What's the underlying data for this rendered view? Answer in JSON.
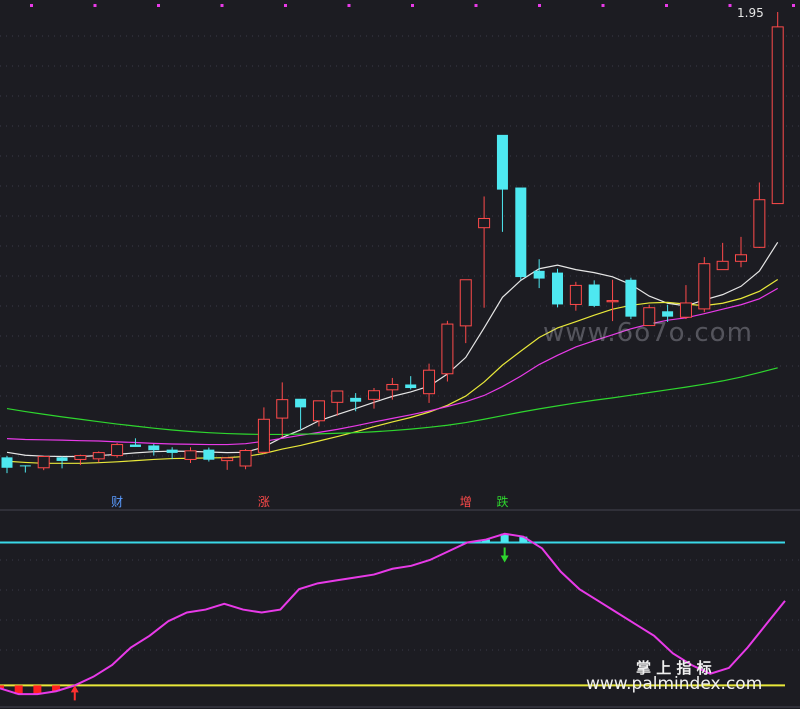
{
  "chart_data": [
    {
      "type": "candlestick",
      "price_label": "1.95",
      "ylim": [
        0,
        100
      ],
      "candles": [
        {
          "o": 50.3,
          "h": 50.8,
          "l": 45.0,
          "c": 46.8,
          "up": false
        },
        {
          "o": 47.6,
          "h": 47.6,
          "l": 45.2,
          "c": 47.5,
          "up": false
        },
        {
          "o": 46.8,
          "h": 50.7,
          "l": 46.0,
          "c": 50.6,
          "up": true
        },
        {
          "o": 49.1,
          "h": 50.6,
          "l": 46.6,
          "c": 50.3,
          "up": false
        },
        {
          "o": 49.6,
          "h": 51.2,
          "l": 47.7,
          "c": 50.9,
          "up": true
        },
        {
          "o": 49.8,
          "h": 52.3,
          "l": 48.6,
          "c": 51.9,
          "up": true
        },
        {
          "o": 50.9,
          "h": 55.1,
          "l": 50.2,
          "c": 54.6,
          "up": true
        },
        {
          "o": 54.6,
          "h": 56.7,
          "l": 53.9,
          "c": 53.8,
          "up": false
        },
        {
          "o": 54.3,
          "h": 54.8,
          "l": 50.9,
          "c": 52.7,
          "up": false
        },
        {
          "o": 52.9,
          "h": 53.7,
          "l": 49.7,
          "c": 51.8,
          "up": false
        },
        {
          "o": 49.6,
          "h": 53.7,
          "l": 48.4,
          "c": 52.5,
          "up": true
        },
        {
          "o": 52.9,
          "h": 53.6,
          "l": 48.9,
          "c": 49.5,
          "up": false
        },
        {
          "o": 49.2,
          "h": 50.4,
          "l": 46.1,
          "c": 50.1,
          "up": true
        },
        {
          "o": 47.4,
          "h": 53.1,
          "l": 46.3,
          "c": 52.6,
          "up": true
        },
        {
          "o": 52.0,
          "h": 67.1,
          "l": 51.5,
          "c": 63.1,
          "up": true
        },
        {
          "o": 63.5,
          "h": 75.5,
          "l": 57.1,
          "c": 69.7,
          "up": true
        },
        {
          "o": 70.0,
          "h": 68.4,
          "l": 59.8,
          "c": 67.1,
          "up": false
        },
        {
          "o": 62.6,
          "h": 69.4,
          "l": 60.7,
          "c": 69.3,
          "up": true
        },
        {
          "o": 68.8,
          "h": 72.5,
          "l": 64.3,
          "c": 72.6,
          "up": true
        },
        {
          "o": 70.3,
          "h": 71.9,
          "l": 65.8,
          "c": 69.0,
          "up": false
        },
        {
          "o": 69.8,
          "h": 73.6,
          "l": 66.7,
          "c": 72.7,
          "up": true
        },
        {
          "o": 73.0,
          "h": 77.0,
          "l": 69.7,
          "c": 74.8,
          "up": true
        },
        {
          "o": 73.6,
          "h": 77.6,
          "l": 73.1,
          "c": 74.8,
          "up": false
        },
        {
          "o": 71.7,
          "h": 81.8,
          "l": 68.6,
          "c": 79.6,
          "up": true
        },
        {
          "o": 78.4,
          "h": 96.2,
          "l": 75.8,
          "c": 95.1,
          "up": true
        },
        {
          "o": 94.5,
          "h": 108.9,
          "l": 88.7,
          "c": 110.0,
          "up": true
        },
        {
          "o": 127.5,
          "h": 138.0,
          "l": 100.6,
          "c": 130.6,
          "up": true
        },
        {
          "o": 158.7,
          "h": 154.7,
          "l": 126.1,
          "c": 140.3,
          "up": false
        },
        {
          "o": 141.0,
          "h": 140.6,
          "l": 110.0,
          "c": 110.9,
          "up": false
        },
        {
          "o": 113.0,
          "h": 116.9,
          "l": 107.2,
          "c": 110.4,
          "up": false
        },
        {
          "o": 112.4,
          "h": 113.7,
          "l": 100.7,
          "c": 101.7,
          "up": false
        },
        {
          "o": 101.7,
          "h": 109.3,
          "l": 99.6,
          "c": 108.1,
          "up": true
        },
        {
          "o": 108.4,
          "h": 109.8,
          "l": 100.8,
          "c": 101.2,
          "up": false
        },
        {
          "o": 102.6,
          "h": 110.0,
          "l": 96.1,
          "c": 103.0,
          "up": true
        },
        {
          "o": 110.0,
          "h": 110.7,
          "l": 96.8,
          "c": 97.6,
          "up": false
        },
        {
          "o": 94.6,
          "h": 101.6,
          "l": 94.5,
          "c": 100.6,
          "up": true
        },
        {
          "o": 99.4,
          "h": 101.6,
          "l": 95.8,
          "c": 97.6,
          "up": false
        },
        {
          "o": 97.4,
          "h": 108.2,
          "l": 96.8,
          "c": 102.2,
          "up": true
        },
        {
          "o": 100.2,
          "h": 117.6,
          "l": 99.1,
          "c": 115.4,
          "up": true
        },
        {
          "o": 113.4,
          "h": 122.4,
          "l": 113.9,
          "c": 116.2,
          "up": true
        },
        {
          "o": 116.2,
          "h": 124.4,
          "l": 114.2,
          "c": 118.4,
          "up": true
        },
        {
          "o": 120.9,
          "h": 142.7,
          "l": 120.7,
          "c": 136.9,
          "up": true
        },
        {
          "o": 135.6,
          "h": 200.0,
          "l": 138.3,
          "c": 195.0,
          "up": true
        }
      ],
      "ma_series": [
        {
          "color": "#e6e6e6",
          "values": [
            52,
            51,
            50.7,
            50.6,
            50.6,
            50.9,
            51.3,
            51.8,
            52.2,
            52.4,
            52.3,
            52.1,
            51.9,
            52.0,
            53.8,
            57.0,
            59.5,
            62.6,
            64.7,
            66.7,
            68.8,
            70.8,
            72.3,
            74.2,
            78.3,
            83.9,
            93.8,
            104.1,
            109.8,
            113.7,
            114.9,
            113.4,
            112.4,
            111.0,
            108.4,
            104.5,
            102.1,
            101.2,
            103.2,
            105.0,
            107.8,
            112.9,
            122.6
          ]
        },
        {
          "color": "#e8e83a",
          "values": [
            49,
            48.6,
            48.3,
            48.3,
            48.3,
            48.5,
            48.8,
            49.2,
            49.6,
            49.9,
            50.0,
            50.1,
            50.2,
            50.6,
            51.6,
            53.1,
            54.3,
            55.8,
            57.3,
            58.9,
            60.6,
            62.2,
            63.7,
            65.5,
            67.8,
            70.9,
            75.6,
            81.3,
            86.0,
            90.6,
            93.8,
            95.9,
            98.1,
            100.1,
            101.4,
            102.2,
            102.4,
            101.8,
            101.3,
            102.1,
            103.7,
            106.1,
            110.1
          ]
        },
        {
          "color": "#e83ae8",
          "values": [
            56.6,
            56.3,
            56.2,
            56.1,
            55.9,
            55.8,
            55.5,
            55.3,
            55.0,
            54.8,
            54.7,
            54.6,
            54.6,
            54.9,
            55.7,
            56.7,
            57.7,
            58.7,
            59.7,
            60.9,
            62.2,
            63.4,
            64.6,
            65.9,
            67.4,
            69.0,
            71.1,
            74.1,
            77.6,
            81.5,
            84.6,
            87.4,
            89.5,
            91.5,
            93.5,
            95.1,
            96.4,
            97.2,
            98.6,
            100.1,
            101.6,
            103.6,
            107.1
          ]
        },
        {
          "color": "#2ed62e",
          "values": [
            66.7,
            65.7,
            64.8,
            63.9,
            63.1,
            62.3,
            61.5,
            60.8,
            60.1,
            59.5,
            59.0,
            58.6,
            58.3,
            58.1,
            58.0,
            58.0,
            58.1,
            58.2,
            58.4,
            58.6,
            58.9,
            59.3,
            59.8,
            60.4,
            61.1,
            62.0,
            63.1,
            64.3,
            65.5,
            66.6,
            67.6,
            68.6,
            69.5,
            70.3,
            71.2,
            72.1,
            73.0,
            73.9,
            74.9,
            76.0,
            77.3,
            78.8,
            80.4
          ]
        }
      ],
      "markers": [
        {
          "label": "财",
          "index": 6,
          "color": "#5a9bff"
        },
        {
          "label": "涨",
          "index": 14,
          "color": "#ff4a4a"
        },
        {
          "label": "增",
          "index": 25,
          "color": "#ff4a4a"
        },
        {
          "label": "跌",
          "index": 27,
          "color": "#2ed62e"
        }
      ],
      "watermark": "www.6o7o.com"
    },
    {
      "type": "line",
      "x": [
        0,
        1,
        2,
        3,
        4,
        5,
        6,
        7,
        8,
        9,
        10,
        11,
        12,
        13,
        14,
        15,
        16,
        17,
        18,
        19,
        20,
        21,
        22,
        23,
        24,
        25,
        26,
        27,
        28,
        29,
        30,
        31,
        32,
        33,
        34,
        35,
        36,
        37,
        38,
        39,
        40,
        41,
        42
      ],
      "series": [
        {
          "color": "#e83ae8",
          "values": [
            4,
            2,
            2,
            3,
            5,
            8,
            12,
            18,
            22,
            27,
            30,
            31,
            33,
            31,
            30,
            31,
            38,
            40,
            41,
            42,
            43,
            45,
            46,
            48,
            51,
            54,
            55,
            57,
            56,
            52,
            44,
            38,
            34,
            30,
            26,
            22,
            16,
            12,
            9,
            11,
            18,
            26,
            34
          ]
        }
      ],
      "hlines": [
        {
          "value": 54,
          "color": "#3ad8e8"
        },
        {
          "value": 5,
          "color": "#e8e83a"
        }
      ],
      "ylim": [
        0,
        60
      ],
      "arrows": [
        {
          "index": 4,
          "dir": "up",
          "color": "#ff3030"
        },
        {
          "index": 27,
          "dir": "down",
          "color": "#2ed62e"
        }
      ],
      "watermark_top": "掌 上 指 标",
      "watermark_bottom": "www.palmindex.com"
    }
  ]
}
